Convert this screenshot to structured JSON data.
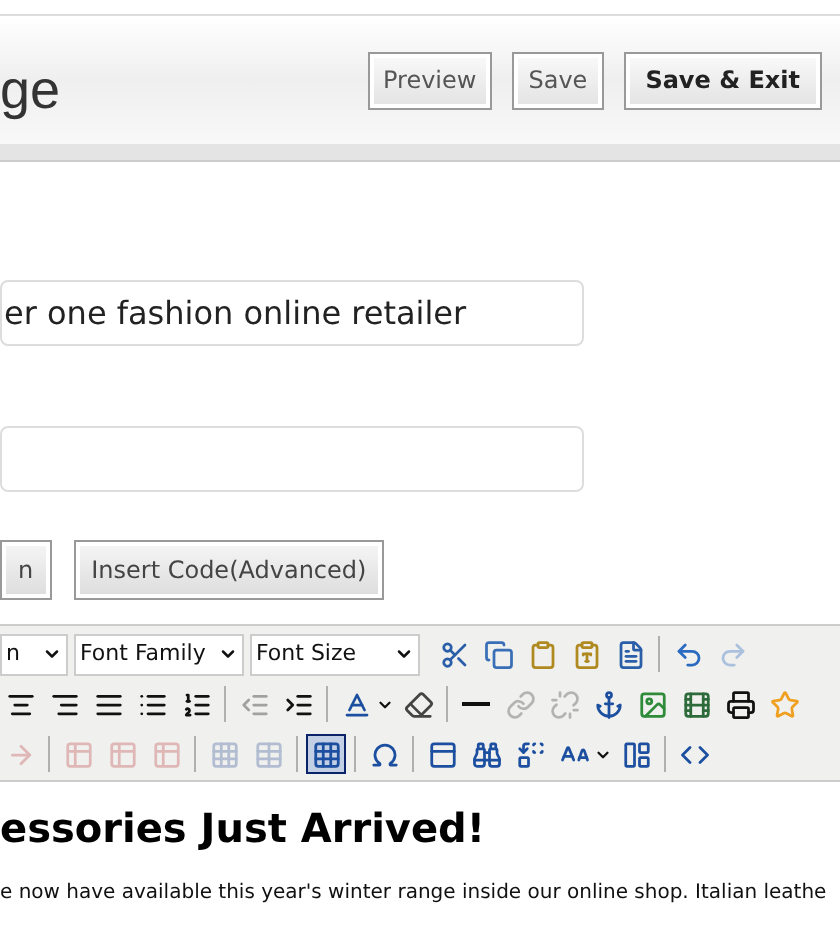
{
  "header": {
    "title": "ge",
    "buttons": [
      {
        "label": "Preview",
        "primary": false
      },
      {
        "label": "Save",
        "primary": false
      },
      {
        "label": "Save & Exit",
        "primary": true
      }
    ]
  },
  "fields": [
    {
      "kind": "text",
      "value": "er one fashion online retailer"
    },
    {
      "kind": "text"
    }
  ],
  "insert_buttons": [
    {
      "label": "n"
    },
    {
      "label": "Insert Code(Advanced)"
    }
  ],
  "editor": {
    "selects": [
      {
        "label": "n"
      },
      {
        "label": "Font Family"
      },
      {
        "label": "Font Size"
      }
    ],
    "toolbar_rows": [
      [
        {
          "kind": "cut",
          "disabled": false,
          "active": false
        },
        {
          "kind": "copy",
          "disabled": false,
          "active": false
        },
        {
          "kind": "paste",
          "disabled": false,
          "active": false
        },
        {
          "kind": "paste-text",
          "disabled": false,
          "active": false
        },
        {
          "kind": "paste-word",
          "disabled": false,
          "active": false
        },
        {
          "kind": "sep"
        },
        {
          "kind": "undo",
          "disabled": false,
          "active": false
        },
        {
          "kind": "redo",
          "disabled": true,
          "active": false
        }
      ],
      [
        {
          "kind": "align-center",
          "disabled": false,
          "active": false
        },
        {
          "kind": "align-right",
          "disabled": false,
          "active": false
        },
        {
          "kind": "justify",
          "disabled": false,
          "active": false
        },
        {
          "kind": "bullets",
          "disabled": false,
          "active": false
        },
        {
          "kind": "numbers",
          "disabled": false,
          "active": false
        },
        {
          "kind": "sep"
        },
        {
          "kind": "outdent",
          "disabled": true,
          "active": false
        },
        {
          "kind": "indent",
          "disabled": false,
          "active": false
        },
        {
          "kind": "sep"
        },
        {
          "kind": "font-color",
          "disabled": false,
          "active": false
        },
        {
          "kind": "eraser",
          "disabled": false,
          "active": false
        },
        {
          "kind": "sep"
        },
        {
          "kind": "rule",
          "disabled": false,
          "active": false
        },
        {
          "kind": "link",
          "disabled": true,
          "active": false
        },
        {
          "kind": "unlink",
          "disabled": true,
          "active": false
        },
        {
          "kind": "anchor",
          "disabled": false,
          "active": false
        },
        {
          "kind": "image",
          "disabled": false,
          "active": false
        },
        {
          "kind": "media",
          "disabled": false,
          "active": false
        },
        {
          "kind": "print",
          "disabled": false,
          "active": false
        },
        {
          "kind": "star",
          "disabled": false,
          "active": false
        }
      ],
      [
        {
          "kind": "arrow",
          "disabled": true,
          "active": false
        },
        {
          "kind": "sep"
        },
        {
          "kind": "row-before",
          "disabled": true,
          "active": false
        },
        {
          "kind": "row-after",
          "disabled": true,
          "active": false
        },
        {
          "kind": "row-delete",
          "disabled": true,
          "active": false
        },
        {
          "kind": "sep"
        },
        {
          "kind": "cells",
          "disabled": true,
          "active": false
        },
        {
          "kind": "merge",
          "disabled": true,
          "active": false
        },
        {
          "kind": "sep"
        },
        {
          "kind": "table",
          "disabled": false,
          "active": true
        },
        {
          "kind": "sep"
        },
        {
          "kind": "omega",
          "disabled": false,
          "active": false
        },
        {
          "kind": "sep"
        },
        {
          "kind": "template",
          "disabled": false,
          "active": false
        },
        {
          "kind": "find",
          "disabled": false,
          "active": false
        },
        {
          "kind": "replace",
          "disabled": false,
          "active": false
        },
        {
          "kind": "spellcheck",
          "disabled": false,
          "active": false
        },
        {
          "kind": "layer",
          "disabled": false,
          "active": false
        },
        {
          "kind": "sep"
        },
        {
          "kind": "html",
          "disabled": false,
          "active": false
        }
      ]
    ],
    "heading": "essories Just Arrived!",
    "paragraph": "e now have available this year's winter range inside our online shop. Italian leathe"
  }
}
